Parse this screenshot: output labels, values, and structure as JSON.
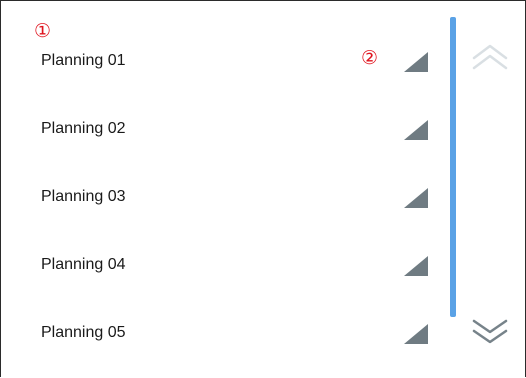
{
  "callouts": {
    "one": "①",
    "two": "②"
  },
  "planning_list": {
    "items": [
      {
        "label": "Planning 01"
      },
      {
        "label": "Planning 02"
      },
      {
        "label": "Planning 03"
      },
      {
        "label": "Planning 04"
      },
      {
        "label": "Planning 05"
      }
    ],
    "toggle_icon": "triangle-corner-icon"
  },
  "scroll": {
    "up_icon": "double-chevron-up-icon",
    "up_state": "disabled",
    "down_icon": "double-chevron-down-icon",
    "down_state": "enabled"
  },
  "colors": {
    "callout": "#e0141e",
    "scrollbar": "#5aa2e6",
    "toggle": "#6f7b82",
    "chevron_disabled": "#d9dfe3",
    "chevron_enabled": "#77838a"
  }
}
